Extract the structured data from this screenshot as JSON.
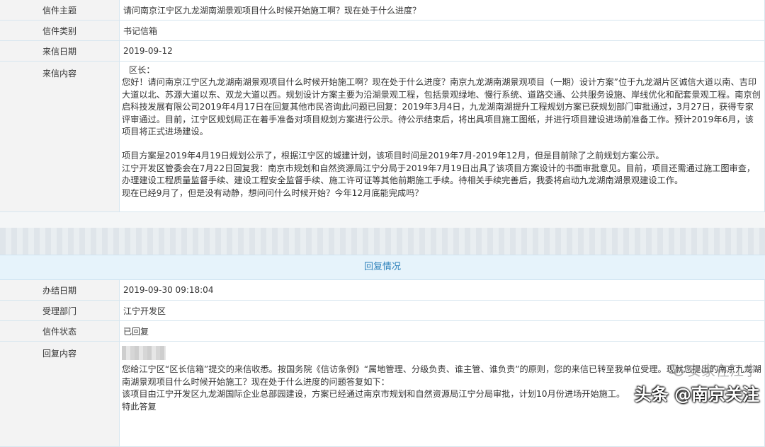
{
  "letter": {
    "subject_label": "信件主题",
    "subject_value": "请问南京江宁区九龙湖南湖景观项目什么时候开始施工啊？现在处于什么进度？",
    "category_label": "信件类别",
    "category_value": "书记信箱",
    "date_label": "来信日期",
    "date_value": "2019-09-12",
    "content_label": "来信内容",
    "content_greeting": "区长：",
    "content_p1": "您好！请问南京江宁区九龙湖南湖景观项目什么时候开始施工啊？现在处于什么进度？南京九龙湖南湖景观项目（一期）设计方案”位于九龙湖片区诚信大道以南、吉印大道以北、苏源大道以东、双龙大道以西。规划设计方案主要为沿湖景观工程，包括景观绿地、慢行系统、道路交通、公共服务设施、岸线优化和配套景观工程。南京创启科技发展有限公司2019年4月17日在回复其他市民咨询此问题已回复：2019年3月4日，九龙湖南湖提升工程规划方案已获规划部门审批通过，3月27日，获得专家评审通过。目前，江宁区规划局正在着手准备对项目规划方案进行公示。待公示结束后，将出具项目施工图纸，并进行项目建设进场前准备工作。预计2019年6月，该项目将正式进场建设。",
    "content_p2": "项目方案是2019年4月19日规划公示了，根据江宁区的城建计划，该项目时间是2019年7月-2019年12月，但是目前除了之前规划方案公示。",
    "content_p3": "江宁开发区管委会在7月22日回复我：南京市规划和自然资源局江宁分局于2019年7月19日出具了该项目方案设计的书面审批意见。目前，项目还需通过施工图审查，办理建设工程质量监督手续、建设工程安全监督手续、施工许可证等其他前期施工手续。待相关手续完善后，我委将启动九龙湖南湖景观建设工作。",
    "content_p4": "现在已经9月了，但是没有动静，想问问什么时候开始？今年12月底能完成吗？"
  },
  "reply": {
    "section_title": "回复情况",
    "handle_date_label": "办结日期",
    "handle_date_value": "2019-09-30 09:18:04",
    "dept_label": "受理部门",
    "dept_value": "江宁开发区",
    "status_label": "信件状态",
    "status_value": "已回复",
    "content_label": "回复内容",
    "content_p1": "您给江宁区“区长信箱”提交的来信收悉。按国务院《信访条例》“属地管理、分级负责、谁主管、谁负责”的原则，您的来信已转至我单位受理。现就您提出的南京九龙湖南湖景观项目什么时候开始施工？现在处于什么进度的问题答复如下：",
    "content_p2": "该项目由江宁开发区九龙湖国际企业总部园建设，方案已经通过南京市规划和自然资源局江宁分局审批，计划10月份进场开始施工。",
    "content_p3": "特此答复"
  },
  "watermark": {
    "account": "安家在江宁",
    "brand": "头条 @南京关注"
  },
  "icons": {
    "wechat": "wechat-icon"
  }
}
